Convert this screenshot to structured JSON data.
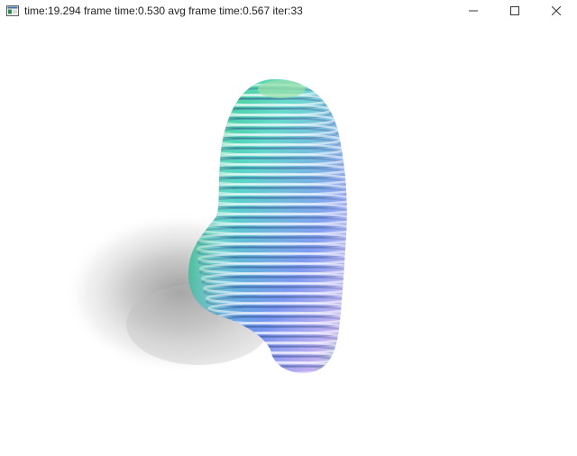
{
  "window": {
    "title": "time:19.294 frame time:0.530 avg frame time:0.567 iter:33",
    "app_icon": "window-app-icon",
    "controls": {
      "minimize_icon": "minimize-icon",
      "maximize_icon": "maximize-icon",
      "close_icon": "close-icon"
    }
  },
  "render": {
    "description_icon": "raymarched-rings-shape",
    "colors": {
      "background": "#ffffff",
      "green": "#3fd07a",
      "cyan": "#5ad6c8",
      "blue": "#6e8ef0",
      "violet": "#b9a3f0",
      "shadow": "#9a9a9a"
    }
  }
}
